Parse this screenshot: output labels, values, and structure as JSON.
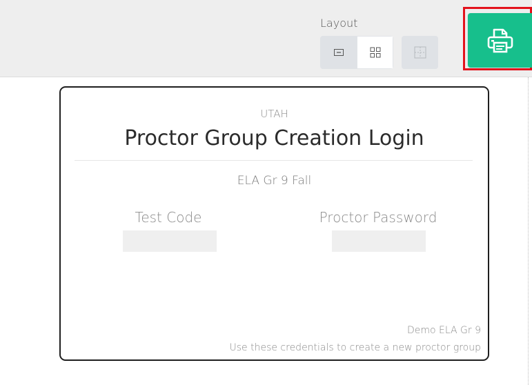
{
  "toolbar": {
    "layout_label": "Layout",
    "layout_options": [
      {
        "icon": "single-card-icon",
        "selected": false
      },
      {
        "icon": "grid-four-icon",
        "selected": true
      }
    ],
    "extra_layout_icon": "grid-lines-icon",
    "print_icon": "printer-icon",
    "colors": {
      "print_bg": "#17bf8c",
      "highlight": "#e3121b"
    }
  },
  "card": {
    "state": "UTAH",
    "title": "Proctor Group Creation Login",
    "test_name": "ELA Gr 9 Fall",
    "fields": [
      {
        "label": "Test Code",
        "value": ""
      },
      {
        "label": "Proctor Password",
        "value": ""
      }
    ],
    "footer_title": "Demo ELA Gr 9",
    "footer_note": "Use these credentials to create a new proctor group"
  }
}
